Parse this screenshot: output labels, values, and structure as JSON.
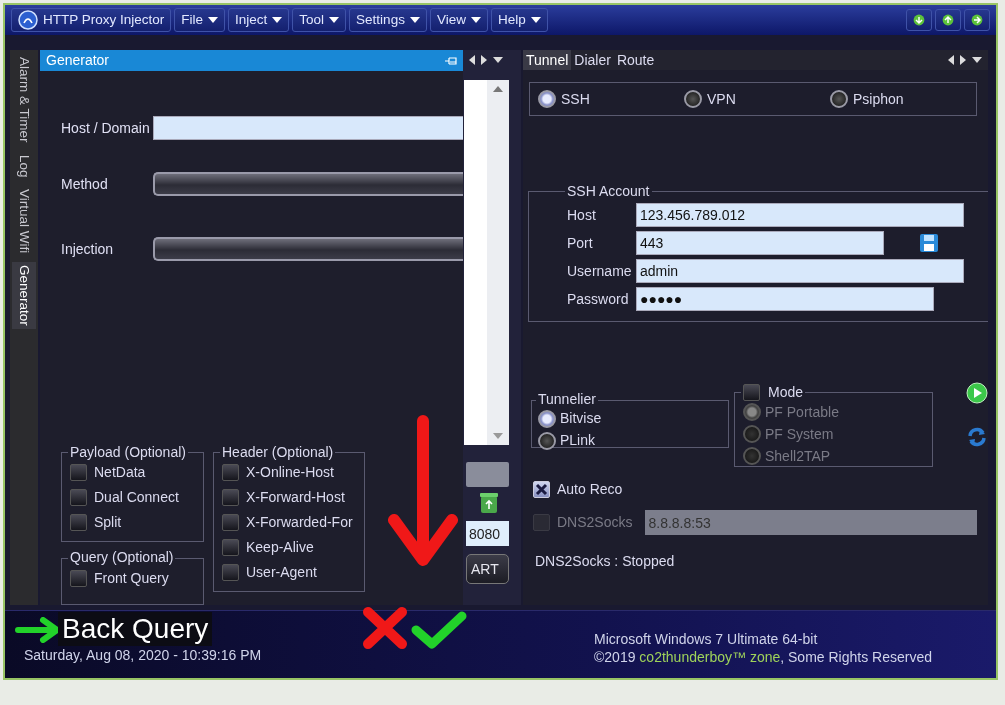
{
  "app": {
    "title": "HTTP Proxy Injector"
  },
  "menu": [
    {
      "label": "File"
    },
    {
      "label": "Inject"
    },
    {
      "label": "Tool"
    },
    {
      "label": "Settings"
    },
    {
      "label": "View"
    },
    {
      "label": "Help"
    }
  ],
  "side_tabs": [
    {
      "label": "Alarm & Timer",
      "selected": false
    },
    {
      "label": "Log",
      "selected": false
    },
    {
      "label": "Virtual Wifi",
      "selected": false
    },
    {
      "label": "Generator",
      "selected": true
    }
  ],
  "generator": {
    "title": "Generator",
    "fields": [
      {
        "label": "Host / Domain",
        "kind": "text"
      },
      {
        "label": "Method",
        "kind": "combo"
      },
      {
        "label": "Injection",
        "kind": "combo"
      }
    ],
    "payload": {
      "title": "Payload (Optional)",
      "options": [
        {
          "label": "NetData",
          "checked": false
        },
        {
          "label": "Dual Connect",
          "checked": false
        },
        {
          "label": "Split",
          "checked": false
        }
      ]
    },
    "query": {
      "title": "Query (Optional)",
      "options": [
        {
          "label": "Front Query",
          "checked": false
        }
      ]
    },
    "header": {
      "title": "Header (Optional)",
      "options": [
        {
          "label": "X-Online-Host",
          "checked": false
        },
        {
          "label": "X-Forward-Host",
          "checked": false
        },
        {
          "label": "X-Forwarded-For",
          "checked": false
        },
        {
          "label": "Keep-Alive",
          "checked": false
        },
        {
          "label": "User-Agent",
          "checked": false
        }
      ]
    }
  },
  "middle_panel": {
    "port": "8080",
    "button": "ART"
  },
  "tunnel": {
    "tabs": [
      {
        "label": "Tunnel",
        "selected": true
      },
      {
        "label": "Dialer",
        "selected": false
      },
      {
        "label": "Route",
        "selected": false
      }
    ],
    "protocols": [
      {
        "label": "SSH",
        "selected": true
      },
      {
        "label": "VPN",
        "selected": false
      },
      {
        "label": "Psiphon",
        "selected": false
      }
    ],
    "ssh_account": {
      "title": "SSH Account",
      "fields": [
        {
          "label": "Host",
          "value": "123.456.789.012"
        },
        {
          "label": "Port",
          "value": "443"
        },
        {
          "label": "Username",
          "value": "admin"
        },
        {
          "label": "Password",
          "value": "●●●●●"
        }
      ]
    },
    "tunnelier": {
      "title": "Tunnelier",
      "options": [
        {
          "label": "Bitvise",
          "selected": true
        },
        {
          "label": "PLink",
          "selected": false
        }
      ]
    },
    "mode": {
      "title": "Mode",
      "checked": false,
      "options": [
        {
          "label": "PF Portable",
          "selected": true,
          "disabled": true
        },
        {
          "label": "PF System",
          "selected": false,
          "disabled": true
        },
        {
          "label": "Shell2TAP",
          "selected": false,
          "disabled": true
        }
      ]
    },
    "auto_reco": {
      "label": "Auto Reco",
      "checked": true
    },
    "dns2socks": {
      "label": "DNS2Socks",
      "checked": false,
      "disabled": true,
      "value": "8.8.8.8:53"
    },
    "status": "DNS2Socks : Stopped"
  },
  "footer": {
    "datetime": "Saturday, Aug 08, 2020 - 10:39:16 PM",
    "os": "Microsoft Windows 7 Ultimate  64-bit",
    "year": "©2019",
    "brand": "co2thunderboy™ zone",
    "rights": ", Some Rights Reserved"
  },
  "annotation": {
    "label": "Back Query"
  }
}
